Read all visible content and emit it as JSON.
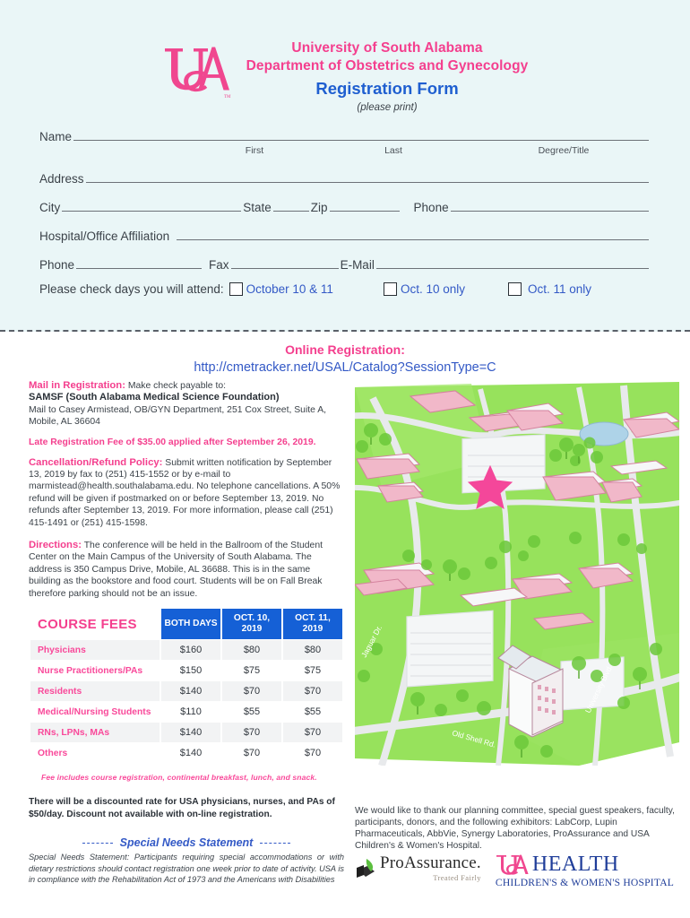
{
  "header": {
    "logo_alt": "USA monogram logo",
    "line1": "University of South Alabama",
    "line2": "Department of Obstetrics and Gynecology",
    "line3": "Registration Form",
    "line4": "(please print)"
  },
  "form": {
    "name_label": "Name",
    "sub_first": "First",
    "sub_last": "Last",
    "sub_degree": "Degree/Title",
    "address_label": "Address",
    "city_label": "City",
    "state_label": "State",
    "zip_label": "Zip",
    "phone_label": "Phone",
    "affiliation_label": "Hospital/Office Affiliation",
    "phone2_label": "Phone",
    "fax_label": "Fax",
    "email_label": "E-Mail",
    "attend_label": "Please check days you will attend:",
    "options": [
      "October 10 & 11",
      "Oct. 10 only",
      "Oct. 11 only"
    ]
  },
  "online": {
    "title": "Online Registration:",
    "url": "http://cmetracker.net/USAL/Catalog?SessionType=C"
  },
  "mail_in": {
    "heading": "Mail in Registration:",
    "intro": " Make check payable to:",
    "payee": "SAMSF (South Alabama Medical Science Foundation)",
    "address": "Mail to Casey Armistead, OB/GYN Department, 251 Cox Street, Suite A, Mobile, AL 36604",
    "late_fee": "Late Registration Fee of $35.00 applied after September 26, 2019."
  },
  "cancellation": {
    "heading": "Cancellation/Refund Policy:",
    "body": " Submit written notification by September 13, 2019  by fax to (251) 415-1552 or by e-mail to marmistead@health.southalabama.edu. No telephone cancellations. A 50% refund will be given if postmarked on or before September 13, 2019. No refunds after September 13, 2019. For more information, please call (251) 415-1491 or (251) 415-1598."
  },
  "directions": {
    "heading": "Directions:",
    "body": " The conference will be held in the Ballroom of the Student Center on the Main Campus of the University of South Alabama. The address is 350 Campus Drive, Mobile, AL 36688. This is in the same building as the bookstore and food court. Students will be on Fall Break therefore parking should not be an issue."
  },
  "fees": {
    "title": "COURSE FEES",
    "columns": [
      "BOTH DAYS",
      "OCT. 10, 2019",
      "OCT. 11, 2019"
    ],
    "rows": [
      {
        "role": "Physicians",
        "both": "$160",
        "oct10": "$80",
        "oct11": "$80"
      },
      {
        "role": "Nurse Practitioners/PAs",
        "both": "$150",
        "oct10": "$75",
        "oct11": "$75"
      },
      {
        "role": "Residents",
        "both": "$140",
        "oct10": "$70",
        "oct11": "$70"
      },
      {
        "role": "Medical/Nursing Students",
        "both": "$110",
        "oct10": "$55",
        "oct11": "$55"
      },
      {
        "role": "RNs, LPNs, MAs",
        "both": "$140",
        "oct10": "$70",
        "oct11": "$70"
      },
      {
        "role": "Others",
        "both": "$140",
        "oct10": "$70",
        "oct11": "$70"
      }
    ],
    "note": "Fee includes course registration, continental breakfast, lunch, and snack.",
    "discount": "There will be a discounted rate for USA physicians, nurses, and PAs of $50/day. Discount not available with on-line registration."
  },
  "special_needs": {
    "heading": "Special Needs Statement",
    "body": "Special Needs Statement: Participants requiring special accommodations or with dietary restrictions should contact registration one week prior to date of activity. USA is in compliance with the Rehabilitation Act of 1973 and the Americans with Disabilities"
  },
  "thanks": {
    "body": "We would like to thank our planning committee, special guest speakers, faculty, participants, donors, and the following exhibitors: LabCorp, Lupin Pharmaceuticals, AbbVie, Synergy Laboratories, ProAssurance and USA Children's & Women's Hospital."
  },
  "sponsors": {
    "proassurance_name": "ProAssurance.",
    "proassurance_tagline": "Treated Fairly",
    "usa_health_word": "HEALTH",
    "usa_health_sub": "CHILDREN'S & WOMEN'S HOSPITAL"
  },
  "map": {
    "alt": "Illustrated aerial map of USA main campus with star marking the Student Center",
    "streets": [
      "Jaguar Dr.",
      "Old Shell Rd.",
      "University Blvd."
    ],
    "marker": "pink-star"
  },
  "colors": {
    "pink": "#f43f8e",
    "blue": "#1f5fd0",
    "table_header_blue": "#1560d6",
    "band_bg": "#eaf6f7",
    "map_green": "#8fe04a"
  }
}
